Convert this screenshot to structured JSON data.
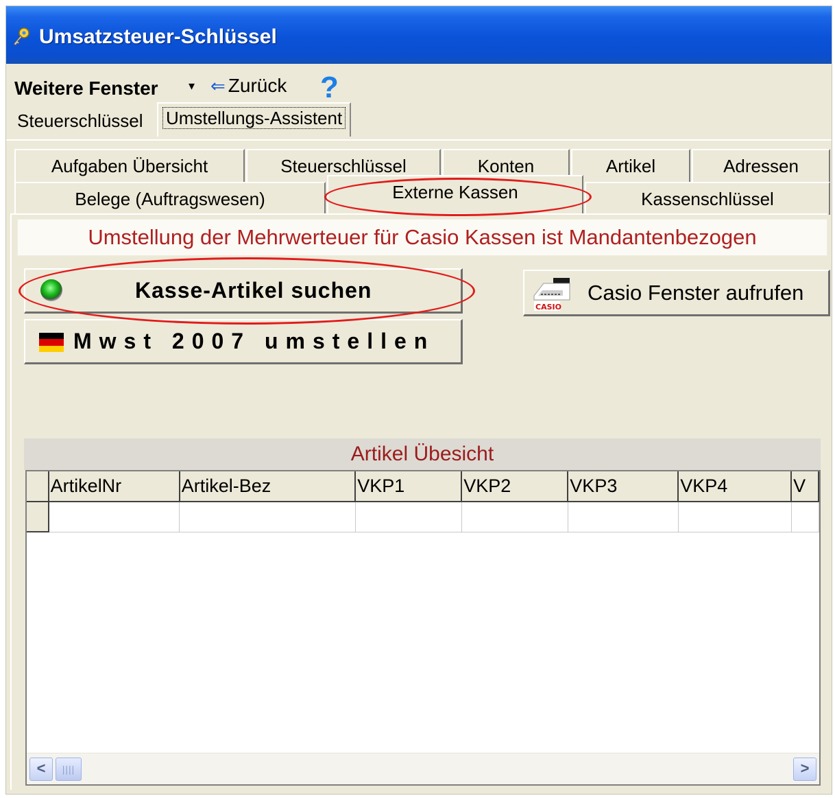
{
  "window": {
    "title": "Umsatzsteuer-Schlüssel"
  },
  "menu": {
    "weitere_fenster": "Weitere Fenster",
    "dropdown_arrow": "▾",
    "back_arrow": "⇐",
    "zurueck": "Zurück",
    "help": "?"
  },
  "top_tabs": [
    {
      "label": "Steuerschlüssel",
      "active": false
    },
    {
      "label": "Umstellungs-Assistent",
      "active": true
    }
  ],
  "sub_tabs": {
    "row1": [
      "Aufgaben Übersicht",
      "Steuerschlüssel",
      "Konten",
      "Artikel",
      "Adressen"
    ],
    "row2": [
      "Belege (Auftragswesen)",
      "Externe Kassen",
      "Kassenschlüssel"
    ],
    "active": "Externe Kassen"
  },
  "banner": {
    "text": "Umstellung der Mehrwerteuer für Casio Kassen ist Mandantenbezogen"
  },
  "buttons": {
    "kasse_artikel": "Kasse-Artikel suchen",
    "mwst": "Mwst 2007 umstellen",
    "casio": "Casio Fenster aufrufen",
    "casio_brand": "CASIO"
  },
  "grid": {
    "title": "Artikel Übesicht",
    "columns": [
      "ArtikelNr",
      "Artikel-Bez",
      "VKP1",
      "VKP2",
      "VKP3",
      "VKP4",
      "V"
    ],
    "rows": []
  },
  "colors": {
    "titlebar": "#0a52d8",
    "banner_text": "#b02020",
    "grid_title_text": "#9b1b1b",
    "annotation": "#e21b1b",
    "window_bg": "#ece9d8"
  },
  "icons": {
    "title": "key-tool-icon",
    "back": "back-arrow-icon",
    "help": "help-question-icon",
    "kasse": "green-led-icon",
    "mwst": "german-flag-icon",
    "casio": "casio-register-icon"
  }
}
